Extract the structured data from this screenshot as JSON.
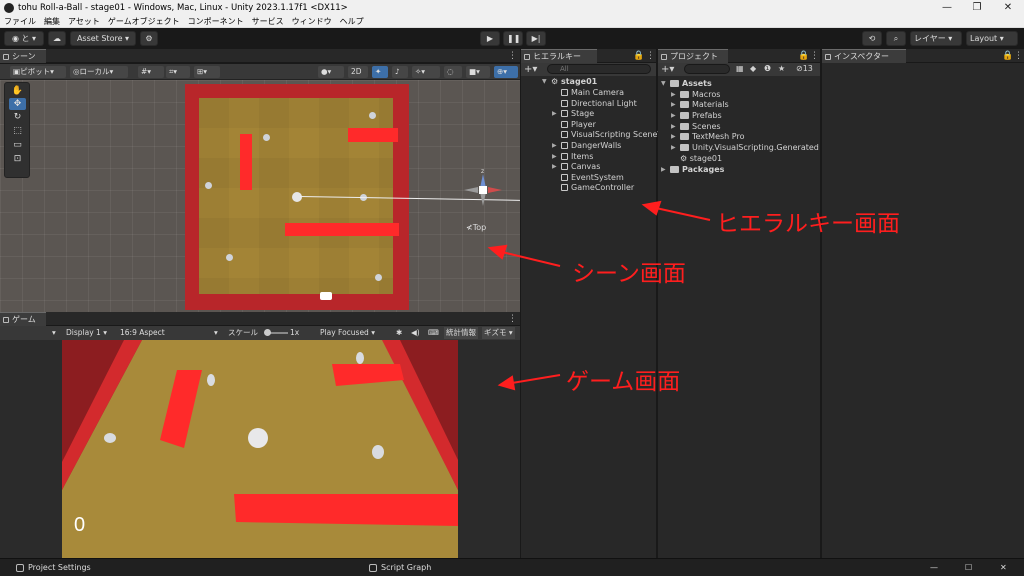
{
  "window": {
    "title": "tohu Roll-a-Ball - stage01 - Windows, Mac, Linux - Unity 2023.1.17f1 <DX11>",
    "controls": [
      "—",
      "❐",
      "✕"
    ]
  },
  "menu": [
    "ファイル",
    "編集",
    "アセット",
    "ゲームオブジェクト",
    "コンポーネント",
    "サービス",
    "ウィンドウ",
    "ヘルプ"
  ],
  "toolbar": {
    "account_label": "と",
    "asset_store_label": "Asset Store",
    "layers_label": "レイヤー",
    "layout_label": "Layout"
  },
  "scene": {
    "tab_label": "シーン",
    "pivot_label": "ピボット",
    "local_label": "ローカル",
    "mode_2d_label": "2D",
    "gizmo_label": "≮Top",
    "gizmo_axis": "z"
  },
  "game": {
    "tab_label": "ゲーム",
    "display_label": "Display 1",
    "aspect_label": "16:9 Aspect",
    "scale_label": "スケール",
    "scale_value": "1x",
    "play_mode_label": "Play Focused",
    "stats_label": "統計情報",
    "gizmos_label": "ギズモ",
    "score": "0"
  },
  "hierarchy": {
    "tab_label": "ヒエラルキー",
    "search_placeholder": "All",
    "scene_name": "stage01",
    "items": [
      {
        "label": "Main Camera",
        "expandable": false
      },
      {
        "label": "Directional Light",
        "expandable": false
      },
      {
        "label": "Stage",
        "expandable": true
      },
      {
        "label": "Player",
        "expandable": false
      },
      {
        "label": "VisualScripting SceneV",
        "expandable": false
      },
      {
        "label": "DangerWalls",
        "expandable": true
      },
      {
        "label": "Items",
        "expandable": true
      },
      {
        "label": "Canvas",
        "expandable": true
      },
      {
        "label": "EventSystem",
        "expandable": false
      },
      {
        "label": "GameController",
        "expandable": false
      }
    ]
  },
  "project": {
    "tab_label": "プロジェクト",
    "hidden_count": "13",
    "root_assets": "Assets",
    "assets": [
      "Macros",
      "Materials",
      "Prefabs",
      "Scenes",
      "TextMesh Pro",
      "Unity.VisualScripting.Generated",
      "stage01"
    ],
    "root_packages": "Packages"
  },
  "inspector": {
    "tab_label": "インスペクター"
  },
  "annotations": {
    "hierarchy": "ヒエラルキー画面",
    "scene": "シーン画面",
    "game": "ゲーム画面"
  },
  "statusbar": {
    "project_settings": "Project Settings",
    "script_graph": "Script Graph"
  },
  "colors": {
    "wall": "#b8262a",
    "floor": "#a38436",
    "danger": "#ff2a2a",
    "annotation": "#ff1e1e"
  }
}
